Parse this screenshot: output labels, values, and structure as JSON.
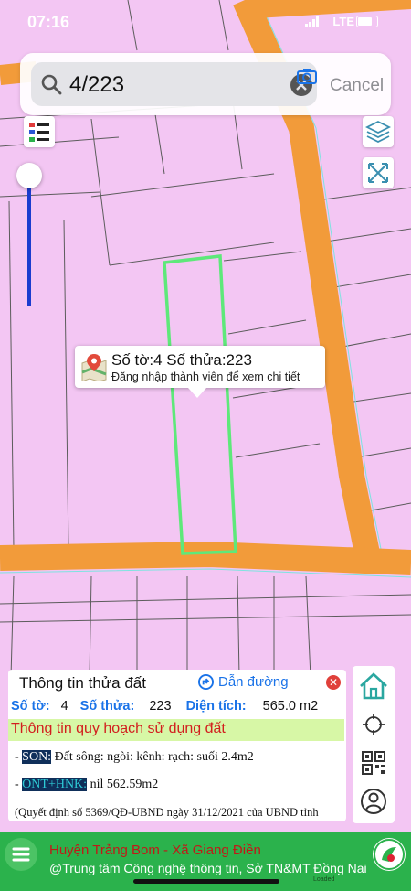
{
  "status_bar": {
    "time": "07:16",
    "network": "LTE"
  },
  "search": {
    "query": "4/223",
    "cancel_label": "Cancel"
  },
  "map_popup": {
    "title": "Số tờ:4 Số thửa:223",
    "subtitle": "Đăng nhập thành viên để xem chi tiết"
  },
  "panel": {
    "title": "Thông tin thửa đất",
    "route_label": "Dẫn đường",
    "sheet_label": "Số tờ:",
    "sheet_value": "4",
    "parcel_label": "Số thửa:",
    "parcel_value": "223",
    "area_label": "Diện tích:",
    "area_value": "565.0 m2",
    "plan_title": "Thông tin quy hoạch sử dụng đất",
    "rules": [
      {
        "prefix": "- ",
        "code": "SON:",
        "text": " Đất sông: ngòi: kênh: rạch: suối 2.4m2"
      },
      {
        "prefix": "- ",
        "code": "ONT+HNK:",
        "text": " nil 562.59m2"
      }
    ],
    "note": "(Quyết định số 5369/QĐ-UBND ngày 31/12/2021 của UBND tỉnh"
  },
  "footer": {
    "line1": "Huyện Trảng Bom - Xã Giang Điền",
    "line2": "@Trung tâm Công nghệ thông tin, Sở TN&MT Đồng Nai",
    "loaded": "Loaded"
  },
  "icons": {
    "search": "search-icon",
    "camera": "camera-icon",
    "legend": "legend-icon",
    "layers": "layers-icon",
    "measure": "measure-icon",
    "marker": "map-pin-icon",
    "route": "directions-icon",
    "close": "close-icon",
    "home": "home-icon",
    "locate": "crosshair-icon",
    "qr": "qr-code-icon",
    "user": "user-icon",
    "menu": "menu-icon"
  },
  "colors": {
    "land": "#f3c6f3",
    "road": "#f29b3a",
    "highlight": "#5ee87a",
    "accent": "#1a73e8",
    "footer": "#2bb24c",
    "plan_bg": "#d7f7a6",
    "plan_text": "#d21e1e"
  }
}
